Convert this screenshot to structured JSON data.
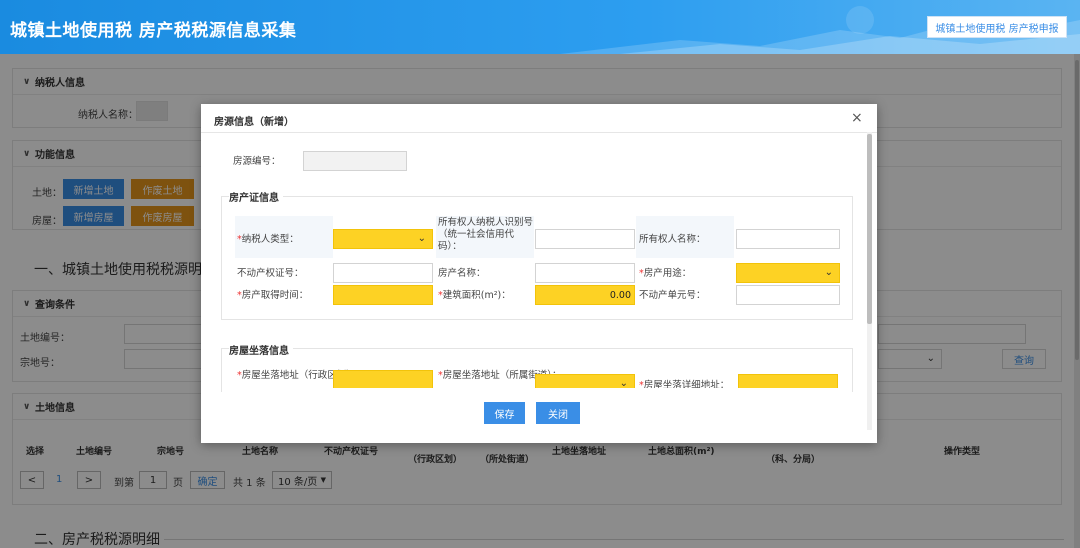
{
  "header": {
    "title": "城镇土地使用税 房产税税源信息采集",
    "top_button": "城镇土地使用税 房产税申报"
  },
  "taxpayer": {
    "section_title": "纳税人信息",
    "name_label": "纳税人名称："
  },
  "function_info": {
    "section_title": "功能信息",
    "land_label": "土地：",
    "house_label": "房屋：",
    "buttons": {
      "new_land": "新增土地",
      "void_land": "作废土地",
      "new_house": "新增房屋",
      "void_house": "作废房屋"
    }
  },
  "section_one_heading": "一、城镇土地使用税税源明",
  "query": {
    "section_title": "查询条件",
    "land_no_label": "土地编号：",
    "parcel_no_label": "宗地号：",
    "search_button": "查询"
  },
  "land_info": {
    "section_title": "土地信息",
    "columns": [
      "选择",
      "土地编号",
      "宗地号",
      "土地名称",
      "不动产权证号",
      "土地坐落地址",
      "土地总面积(m²)",
      "操作类型"
    ],
    "sub_columns": [
      "（行政区划）",
      "（所处街道）",
      "（科、分局）"
    ]
  },
  "pagination": {
    "prev": "<",
    "current_page": "1",
    "next": ">",
    "goto_label": "到第",
    "goto_value": "1",
    "page_unit": "页",
    "confirm": "确定",
    "total": "共 1 条",
    "page_size": "10 条/页"
  },
  "section_two_heading": "二、房产税税源明细",
  "modal": {
    "title": "房源信息（新增）",
    "close_symbol": "×",
    "house_no_label": "房源编号：",
    "cert_group_title": "房产证信息",
    "fields": {
      "taxpayer_type": "纳税人类型：",
      "owner_id": "所有权人纳税人识别号（统一社会信用代码）：",
      "owner_name": "所有权人名称：",
      "property_cert": "不动产权证号：",
      "property_name": "房产名称：",
      "property_use": "房产用途：",
      "acquire_time": "房产取得时间：",
      "building_area": "建筑面积(m²)：",
      "unit_no": "不动产单元号："
    },
    "building_area_value": "0.00",
    "location_group_title": "房屋坐落信息",
    "location_fields": {
      "admin_region": "房屋坐落地址（行政区划）：",
      "street": "房屋坐落地址（所属街道）：",
      "detail": "房屋坐落详细地址："
    },
    "buttons": {
      "save": "保存",
      "close": "关闭"
    }
  }
}
